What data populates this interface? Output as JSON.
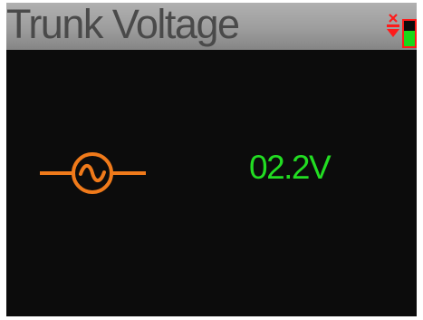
{
  "header": {
    "title": "Trunk Voltage"
  },
  "status": {
    "indicator_icon": "no-power-icon",
    "battery_icon": "battery-icon",
    "battery_level_fraction": 0.6
  },
  "reading": {
    "icon": "ac-source-icon",
    "value": "02.2V"
  },
  "colors": {
    "header_gradient_top": "#b0b0b0",
    "header_gradient_bottom": "#858585",
    "title_text": "#4a4a4a",
    "screen_background": "#0c0c0c",
    "icon_orange": "#f07a1a",
    "value_green": "#22dd22",
    "status_red": "#ff1a1a",
    "battery_green": "#18d918"
  }
}
